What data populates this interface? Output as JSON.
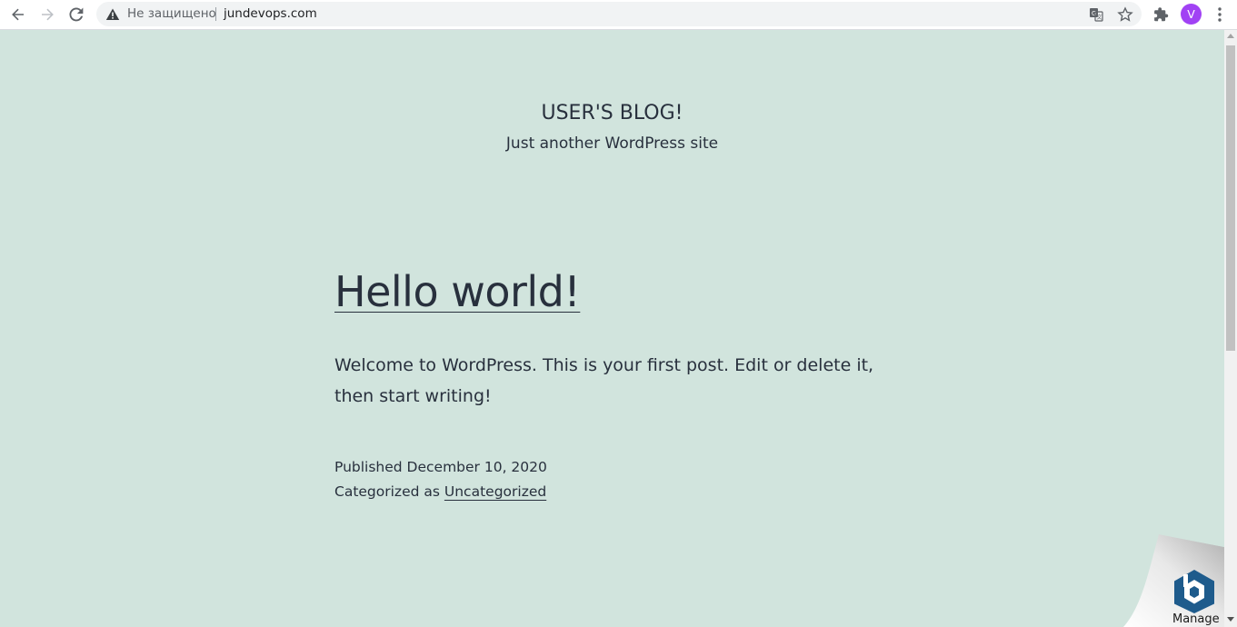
{
  "browser": {
    "security_label": "Не защищено",
    "url": "jundevops.com",
    "profile_initial": "V"
  },
  "site": {
    "title": "USER'S BLOG!",
    "tagline": "Just another WordPress site"
  },
  "post": {
    "title": "Hello world!",
    "body": "Welcome to WordPress. This is your first post. Edit or delete it, then start writing!",
    "published_label": "Published December 10, 2020",
    "categorized_prefix": "Categorized as",
    "category": "Uncategorized"
  },
  "widget": {
    "manage_label": "Manage"
  },
  "colors": {
    "page_background": "#d1e4dd",
    "text": "#28303d",
    "avatar": "#a142f4"
  }
}
